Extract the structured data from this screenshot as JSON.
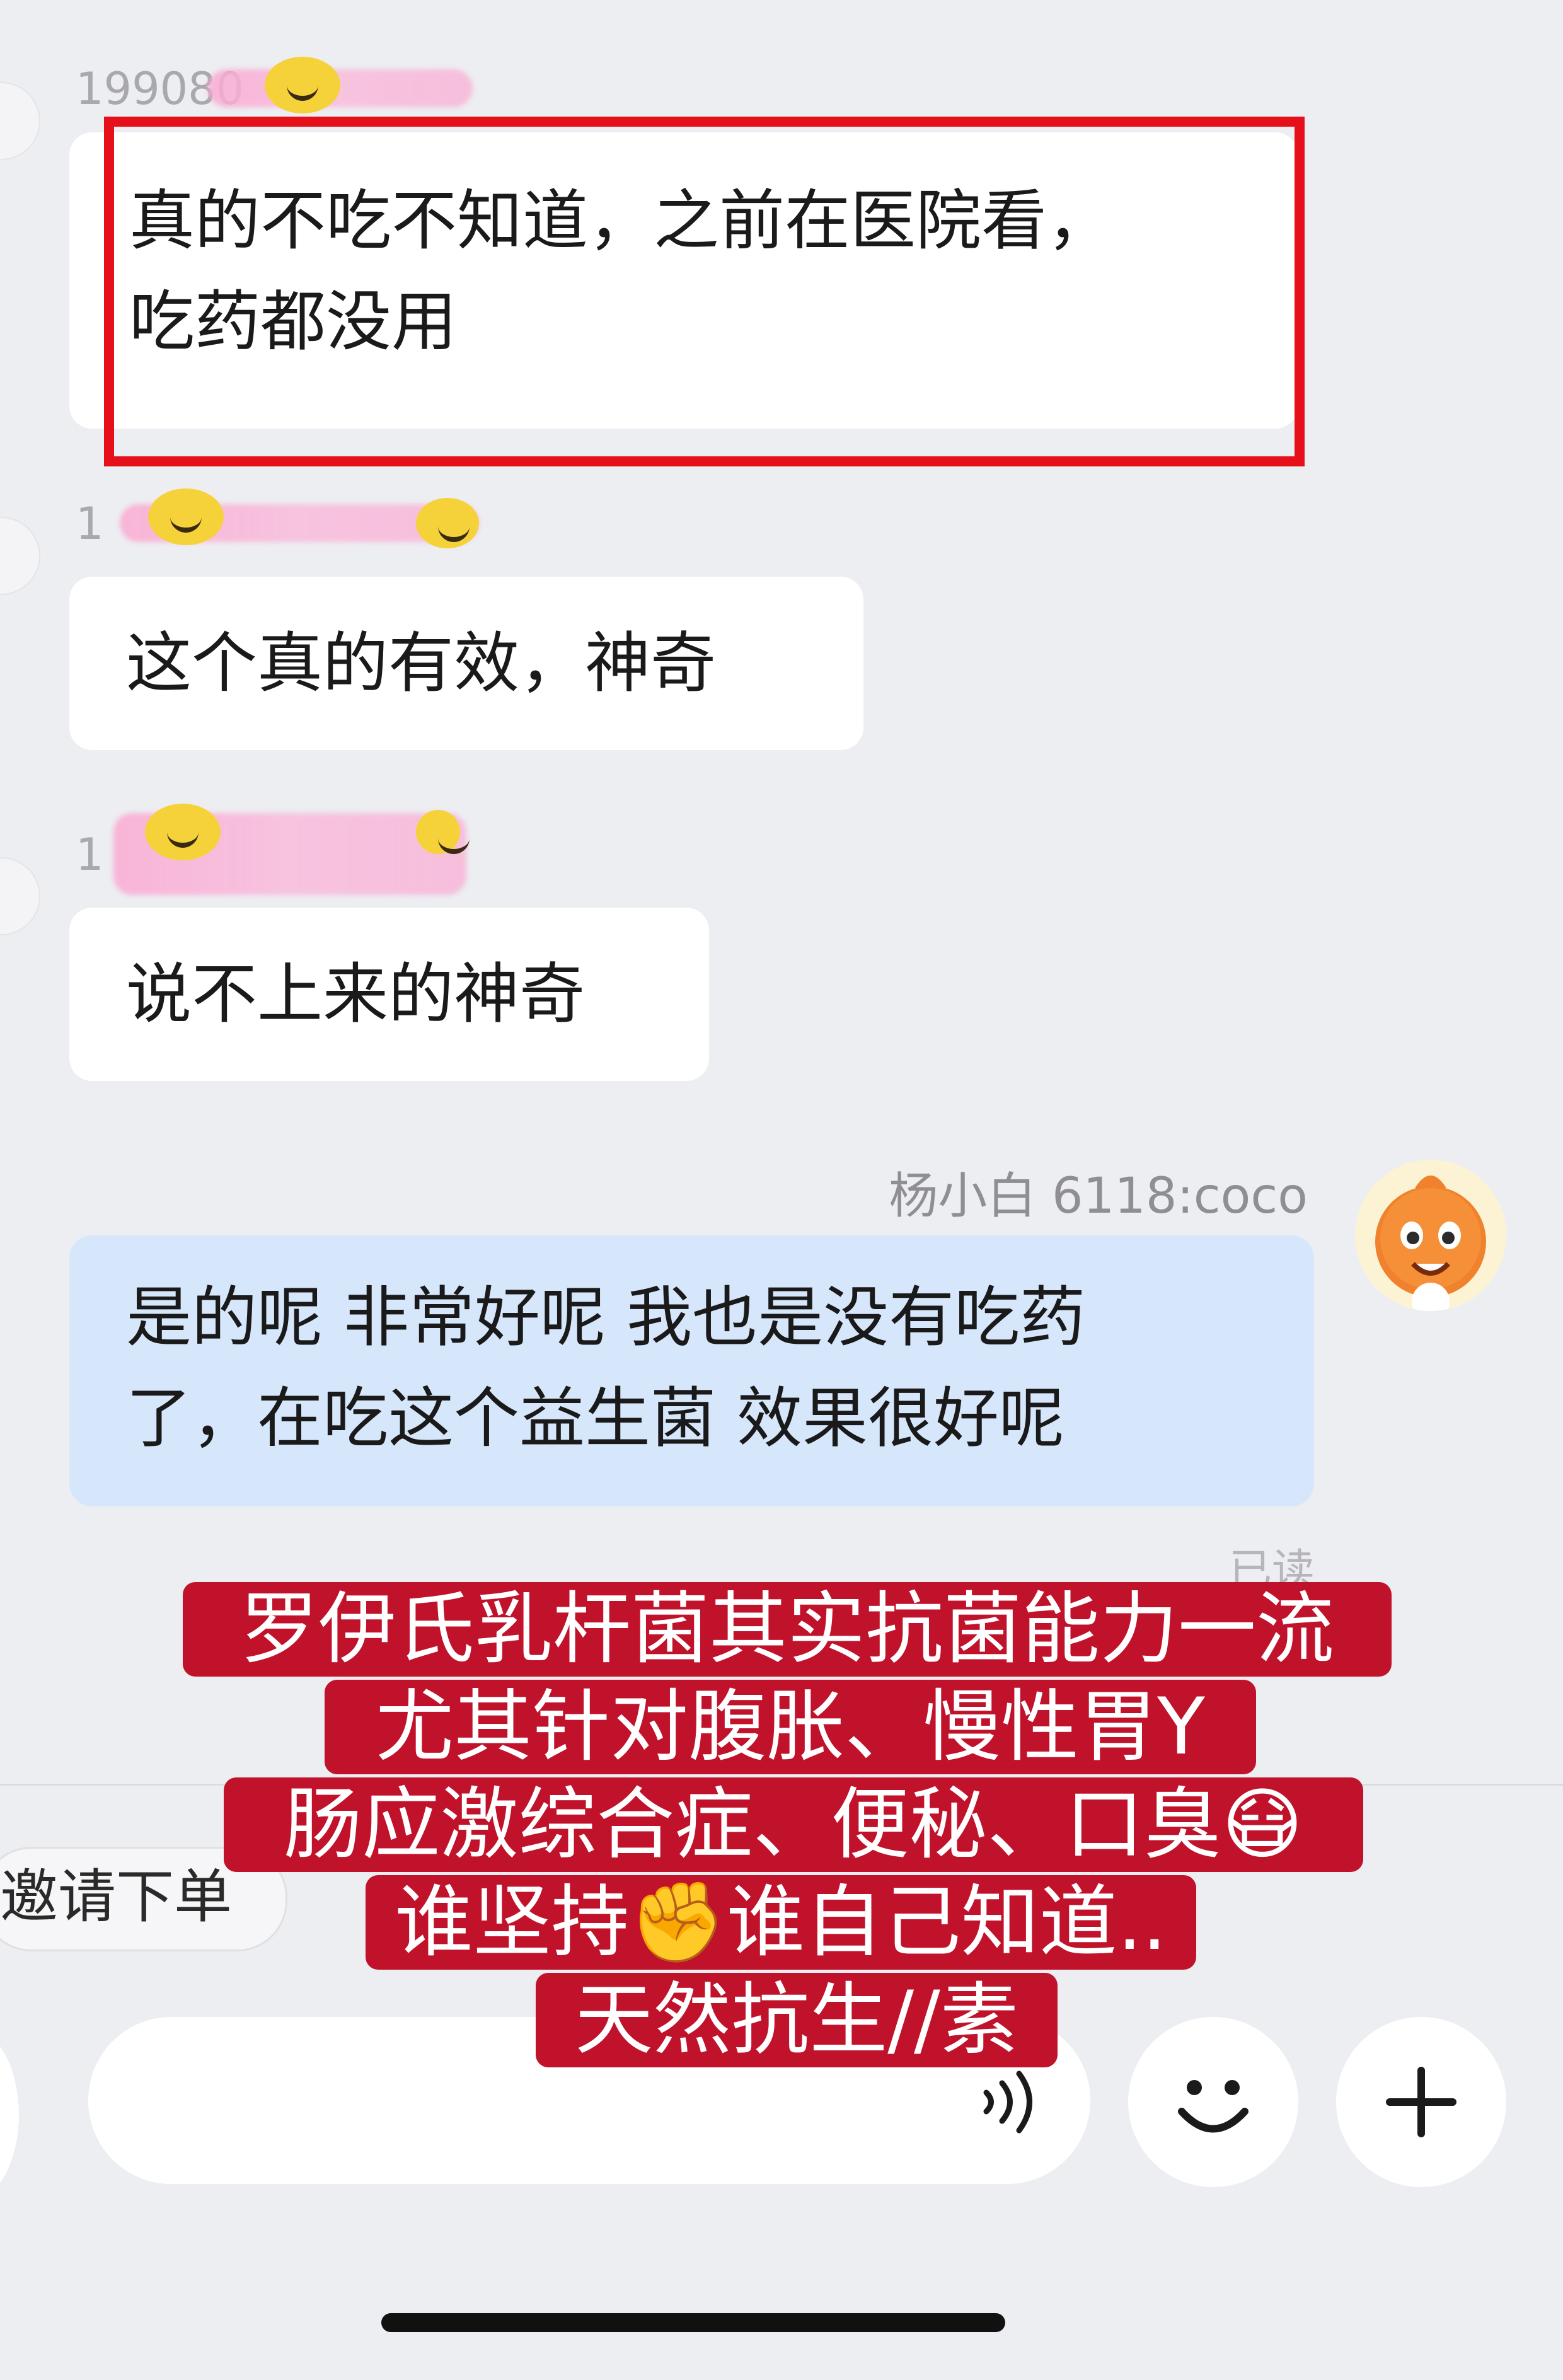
{
  "messages": [
    {
      "sender": "199080",
      "text_line1": "真的不吃不知道，之前在医院看，",
      "text_line2": "吃药都没用"
    },
    {
      "sender": "1",
      "text": "这个真的有效，神奇"
    },
    {
      "sender": "1",
      "text": "说不上来的神奇"
    },
    {
      "sender": "杨小白 6118:coco",
      "text_line1": "是的呢 非常好呢 我也是没有吃药",
      "text_line2": "了，在吃这个益生菌 效果很好呢",
      "status": "已读"
    }
  ],
  "invite_button": "邀请下单",
  "overlay": {
    "line1": "罗伊氏乳杆菌其实抗菌能力一流",
    "line2": "尤其针对腹胀、慢性胃Y",
    "line3": "肠应激综合症、便秘、口臭😷",
    "line4": "谁坚持✊谁自己知道..",
    "line5": "天然抗生//素"
  },
  "input_bar": {
    "voice_icon": "voice-wave-icon",
    "emoji_icon": "smile-icon",
    "plus_icon": "plus-icon"
  },
  "colors": {
    "background": "#EDEEF2",
    "bubble_other": "#FFFFFF",
    "bubble_me": "#D6E6FB",
    "highlight_frame": "#E5101A",
    "overlay_bg": "#C1122B"
  }
}
